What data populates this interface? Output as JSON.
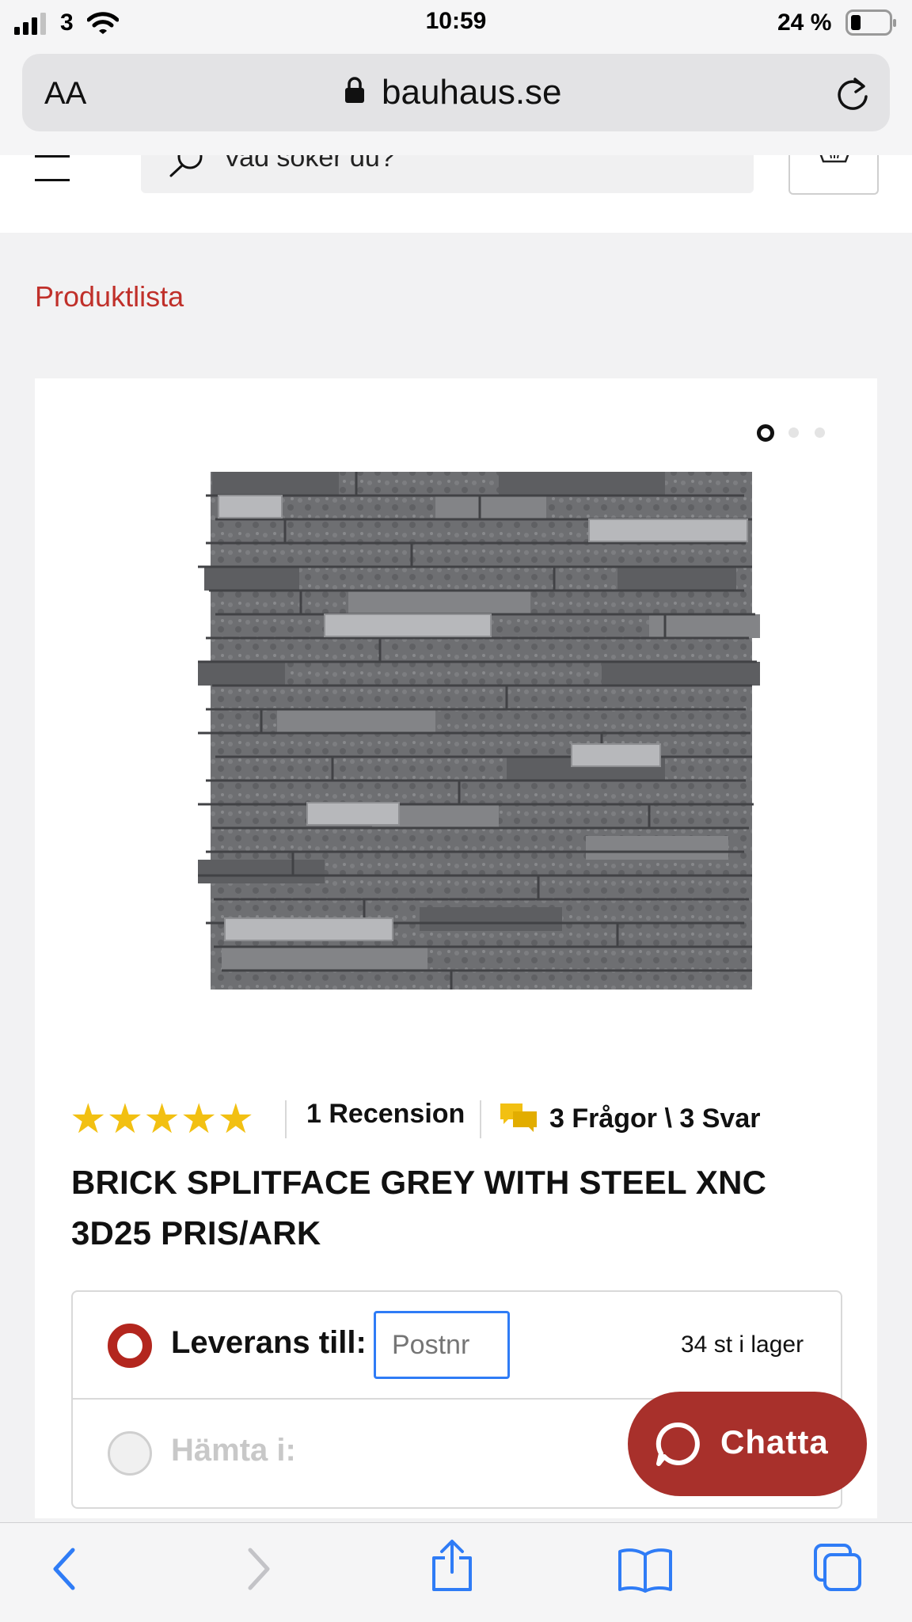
{
  "status_bar": {
    "carrier": "3",
    "time": "10:59",
    "battery": "24 %"
  },
  "browser": {
    "text_size_label": "AA",
    "url": "bauhaus.se"
  },
  "header": {
    "search_placeholder": "Vad söker du?"
  },
  "breadcrumb": {
    "label": "Produktlista"
  },
  "gallery": {
    "dots": 3,
    "active_dot": 1
  },
  "product": {
    "rating": 5,
    "reviews_label": "1 Recension",
    "qa_label": "3 Frågor \\ 3 Svar",
    "title_line1": "BRICK SPLITFACE GREY WITH STEEL XNC",
    "title_line2": "3D25 PRIS/ARK"
  },
  "delivery": {
    "delivery_label": "Leverans till:",
    "postcode_placeholder": "Postnr",
    "stock_label": "34 st i lager",
    "pickup_label": "Hämta i:"
  },
  "chat": {
    "label": "Chatta"
  },
  "colors": {
    "brand_red": "#b3261e",
    "link_red": "#c0302a",
    "chat_bg": "#a8302b",
    "ios_blue": "#2f7cf6",
    "star_yellow": "#f2c012"
  },
  "icons": [
    "signal-icon",
    "wifi-icon",
    "battery-icon",
    "lock-icon",
    "reload-icon",
    "menu-icon",
    "search-icon",
    "cart-icon",
    "star-icon",
    "chat-bubbles-icon",
    "chat-icon",
    "back-icon",
    "forward-icon",
    "share-icon",
    "bookmarks-icon",
    "tabs-icon"
  ]
}
